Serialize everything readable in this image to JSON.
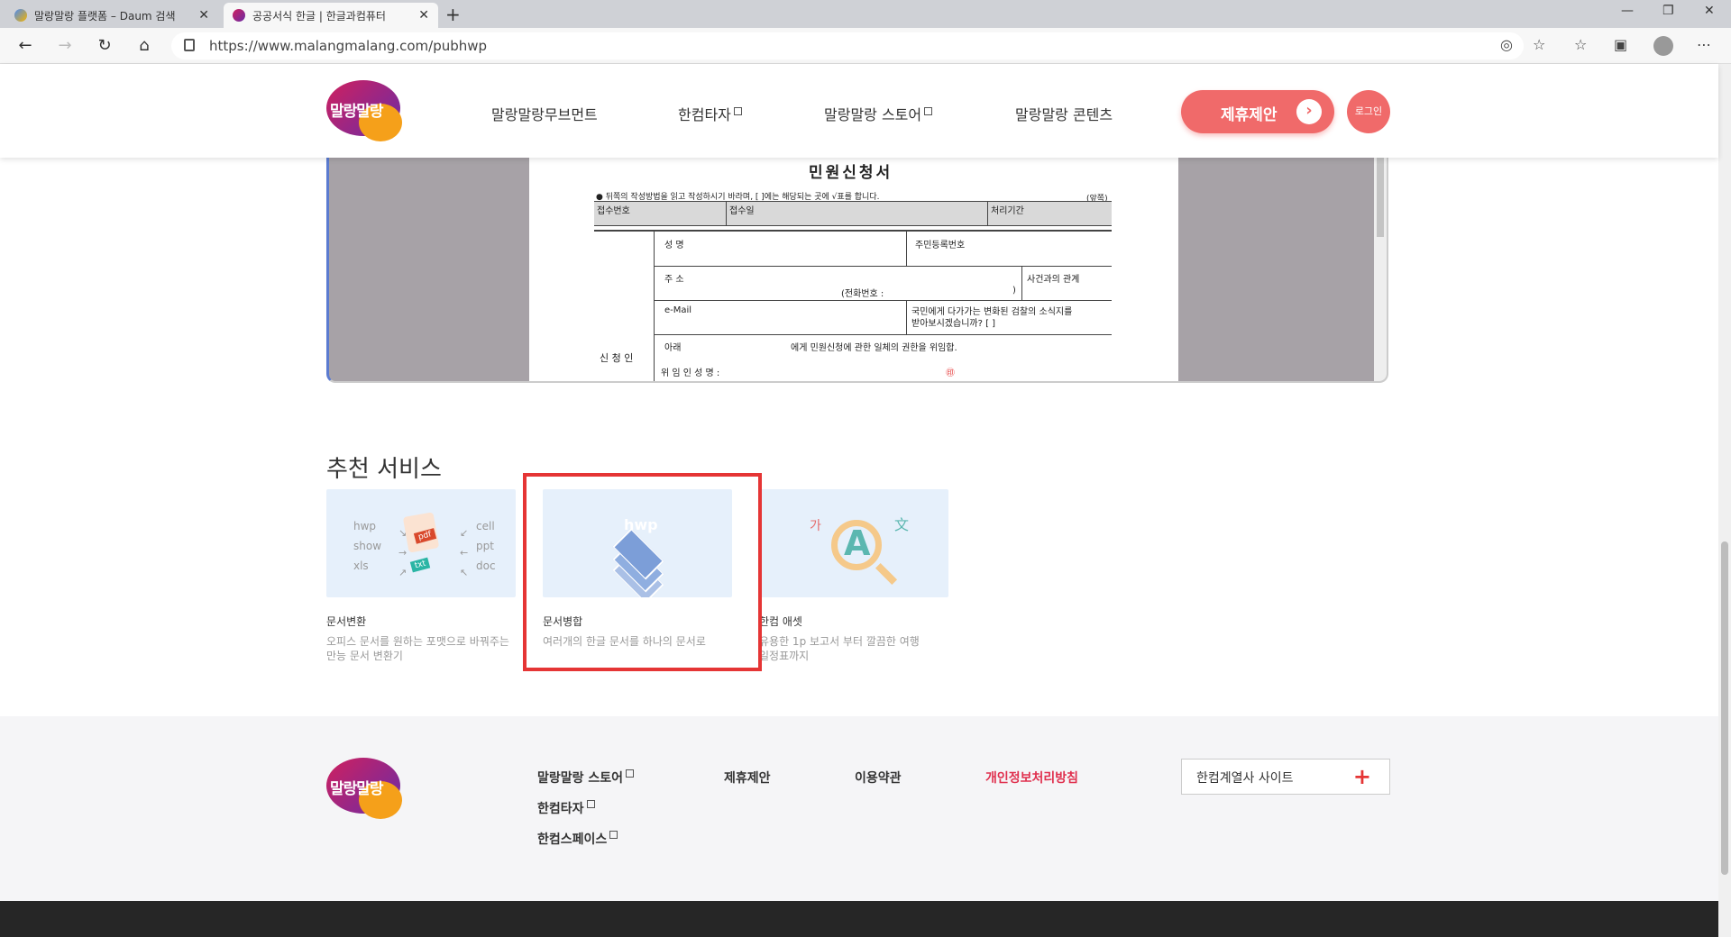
{
  "browser": {
    "tabs": [
      {
        "title": "말랑말랑 플랫폼 – Daum 검색"
      },
      {
        "title": "공공서식 한글 | 한글과컴퓨터"
      }
    ],
    "url": "https://www.malangmalang.com/pubhwp"
  },
  "header": {
    "logo_text": "말랑말랑",
    "nav": [
      "말랑말랑무브먼트",
      "한컴타자",
      "말랑말랑 스토어",
      "말랑말랑 콘텐츠"
    ],
    "cta_label": "제휴제안",
    "login_label": "로그인"
  },
  "preview": {
    "doc_title": "민원신청서",
    "note": "● 뒤쪽의 작성방법을 읽고 작성하시기 바라며, [ ]에는 해당되는 곳에 √표를 합니다.",
    "side_note": "(앞쪽)",
    "receipt_no": "접수번호",
    "receipt_date": "접수일",
    "processing_period": "처리기간",
    "name": "성  명",
    "resident_no": "주민등록번호",
    "address": "주  소",
    "relation": "사건과의 관계",
    "phone": "(전화번호 :",
    "phone_close": ")",
    "email": "e-Mail",
    "notice_q1": "국민에게 다가가는 변화된 검찰의 소식지를",
    "notice_q2": "받아보시겠습니까? [  ]",
    "applicant": "신 청 인",
    "below": "아래",
    "delegate_text": "에게 민원신청에 관한 일체의 권한을 위임합.",
    "delegator": "위 임 인   성 명 :",
    "seal": "㊞"
  },
  "recommend": {
    "title": "추천 서비스",
    "cards": [
      {
        "name": "문서변환",
        "desc1": "오피스 문서를 원하는 포맷으로 바꿔주는",
        "desc2": "만능 문서 변환기",
        "left_labels": [
          "hwp",
          "show",
          "xls"
        ],
        "right_labels": [
          "cell",
          "ppt",
          "doc"
        ],
        "badges": [
          "pdf",
          "txt"
        ]
      },
      {
        "name": "문서병합",
        "desc1": "여러개의 한글 문서를 하나의 문서로",
        "desc2": "",
        "badge": "hwp"
      },
      {
        "name": "한컴 애셋",
        "desc1": "유용한 1p 보고서 부터 깔끔한 여행",
        "desc2": "일정표까지",
        "glyphs": [
          "가",
          "A",
          "文"
        ]
      }
    ]
  },
  "footer": {
    "logo_text": "말랑말랑",
    "col1": [
      "말랑말랑 스토어",
      "한컴타자",
      "한컴스페이스"
    ],
    "proposal": "제휴제안",
    "terms": "이용약관",
    "privacy": "개인정보처리방침",
    "family_site": "한컴계열사 사이트"
  },
  "colors": {
    "accent": "#f06a6a",
    "privacy": "#e0304e",
    "highlight": "#e53535"
  }
}
